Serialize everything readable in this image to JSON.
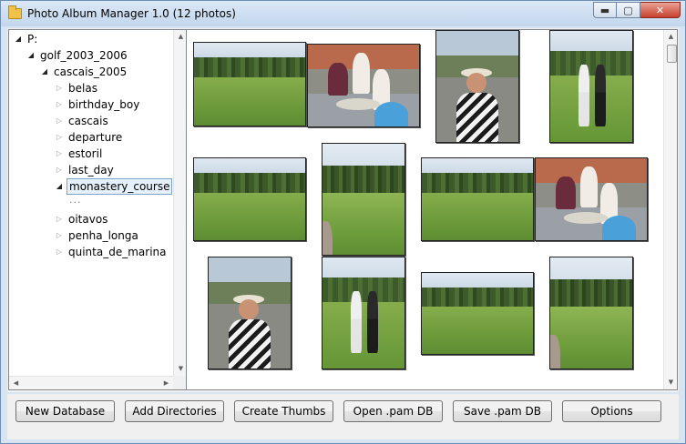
{
  "window": {
    "title": "Photo Album Manager 1.0 (12 photos)",
    "min_glyph": "▬",
    "max_glyph": "▢",
    "close_glyph": "✕"
  },
  "tree": {
    "root": "P:",
    "level1": "golf_2003_2006",
    "level2": "cascais_2005",
    "children": [
      "belas",
      "birthday_boy",
      "cascais",
      "departure",
      "estoril",
      "last_day",
      "monastery_course",
      "oitavos",
      "penha_longa",
      "quinta_de_marina"
    ],
    "selected": "monastery_course",
    "placeholder_child": "..."
  },
  "gallery": {
    "photo_count": 12,
    "photos": [
      "landscape",
      "patio",
      "person",
      "golfers",
      "landscape",
      "portrait",
      "landscape",
      "patio",
      "person",
      "golfers",
      "landscape",
      "portrait"
    ]
  },
  "toolbar": {
    "new_database": "New Database",
    "add_directories": "Add Directories",
    "create_thumbs": "Create Thumbs",
    "open_db": "Open .pam DB",
    "save_db": "Save .pam DB",
    "options": "Options"
  },
  "icons": {
    "expanded_arrow": "◢",
    "collapsed_arrow": "▷",
    "scroll_up": "▲",
    "scroll_down": "▼",
    "scroll_left": "◀",
    "scroll_right": "▶"
  }
}
